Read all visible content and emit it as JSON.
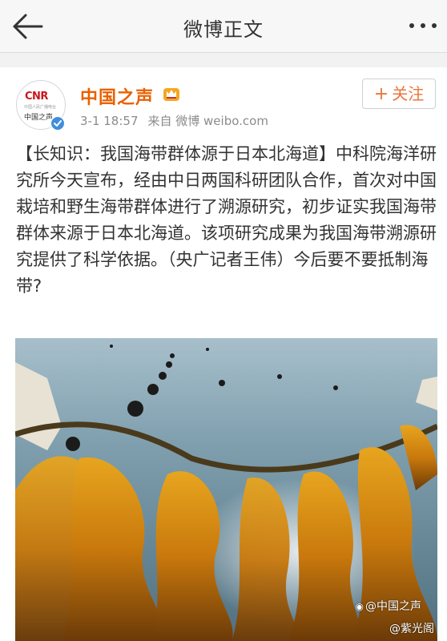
{
  "header": {
    "title": "微博正文",
    "back_icon": "back-arrow-icon",
    "more_icon": "more-dots-icon"
  },
  "post": {
    "author": {
      "name": "中国之声",
      "avatar_logo_text": "CNR",
      "avatar_sub_text": "中国人民广播电台",
      "avatar_name_text": "中国之声",
      "verified_icon": "verified-badge-icon",
      "vip_icon": "vip-crown-icon"
    },
    "time": "3-1 18:57",
    "source": "来自 微博 weibo.com",
    "follow_button": {
      "plus": "+",
      "label": "关注"
    },
    "text": "【长知识：我国海带群体源于日本北海道】中科院海洋研究所今天宣布，经由中日两国科研团队合作，首次对中国栽培和野生海带群体进行了溯源研究，初步证实我国海带群体来源于日本北海道。该项研究成果为我国海带溯源研究提供了科学依据。（央广记者王伟）今后要不要抵制海带?",
    "image": {
      "watermark": "@中国之声",
      "watermark2": "@紫光阁",
      "camera_icon": "camera-icon"
    }
  },
  "colors": {
    "accent": "#e86100",
    "follow": "#e8773b",
    "verified": "#3f8ede",
    "meta": "#8c8c8c"
  }
}
